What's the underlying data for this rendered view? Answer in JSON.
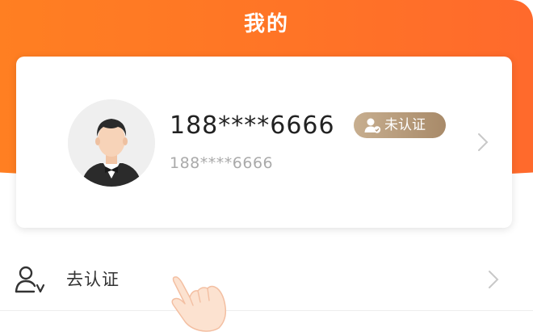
{
  "header": {
    "title": "我的",
    "gradient_start": "#ff7f22",
    "gradient_end": "#ff6a2c"
  },
  "profile": {
    "phone": "188****6666",
    "phone_secondary": "188****6666",
    "avatar_icon": "user-avatar-icon",
    "verify_badge": {
      "icon": "user-verify-icon",
      "label": "未认证",
      "color": "#b69979"
    },
    "chevron_icon": "chevron-right-icon"
  },
  "menu": {
    "items": [
      {
        "icon": "user-verify-outline-icon",
        "label": "去认证",
        "chevron_icon": "chevron-right-icon"
      }
    ]
  },
  "overlay": {
    "cursor_icon": "pointing-hand-icon"
  }
}
